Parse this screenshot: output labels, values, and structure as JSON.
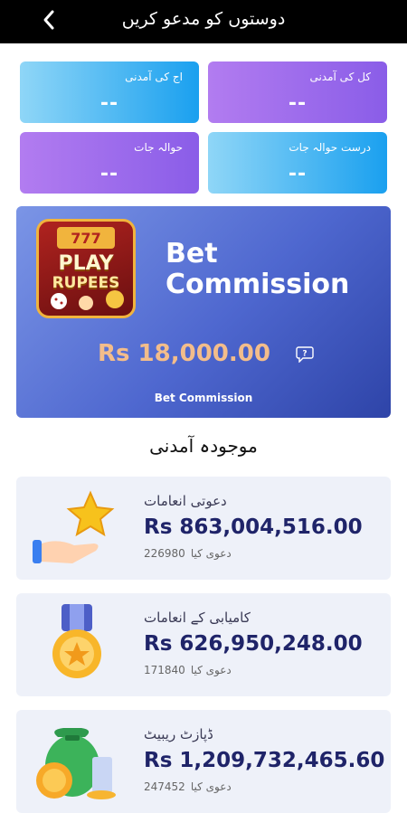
{
  "header": {
    "title": "دوستوں کو مدعو کریں"
  },
  "stats": [
    {
      "label": "کل کی آمدنی",
      "value": "--"
    },
    {
      "label": "اج کی آمدنی",
      "value": "--"
    },
    {
      "label": "درست حوالہ جات",
      "value": "--"
    },
    {
      "label": "حوالہ جات",
      "value": "--"
    }
  ],
  "commission": {
    "logo_line1": "PLAY",
    "logo_line2": "RUPEES",
    "title_line1": "Bet",
    "title_line2": "Commission",
    "amount": "Rs 18,000.00",
    "subtitle": "Bet Commission"
  },
  "section": {
    "title": "موجودہ آمدنی"
  },
  "rewards": [
    {
      "title": "دعوتی انعامات",
      "value": "Rs 863,004,516.00",
      "count": "226980",
      "count_label": "دعوی کیا",
      "icon": "star-hand-icon"
    },
    {
      "title": "کامیابی کے انعامات",
      "value": "Rs 626,950,248.00",
      "count": "171840",
      "count_label": "دعوی کیا",
      "icon": "medal-icon"
    },
    {
      "title": "ڈپازٹ ریبیٹ",
      "value": "Rs 1,209,732,465.60",
      "count": "247452",
      "count_label": "دعوی کیا",
      "icon": "money-bag-icon"
    }
  ]
}
